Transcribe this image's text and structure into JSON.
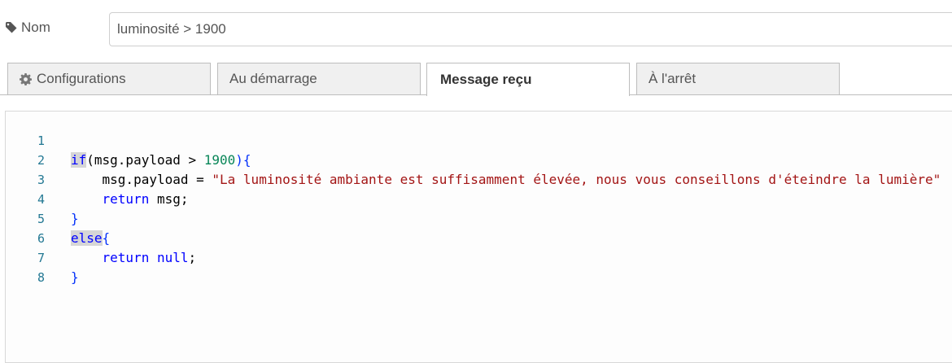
{
  "name_field": {
    "label": "Nom",
    "value": "luminosité > 1900"
  },
  "tabs": [
    {
      "label": "Configurations",
      "icon": "gear-icon",
      "active": false
    },
    {
      "label": "Au démarrage",
      "active": false
    },
    {
      "label": "Message reçu",
      "active": true
    },
    {
      "label": "À l'arrêt",
      "active": false
    }
  ],
  "editor": {
    "line_numbers": [
      "1",
      "2",
      "3",
      "4",
      "5",
      "6",
      "7",
      "8"
    ],
    "lines": {
      "l1": {
        "kw": "if",
        "a": "(msg.payload > ",
        "num": "1900",
        "b": "){"
      },
      "l2": {
        "indent": "    ",
        "a": "msg.payload = ",
        "str": "\"La luminosité ambiante est suffisamment élevée, nous vous conseillons d'éteindre la lumière\""
      },
      "l3": {
        "indent": "    ",
        "kw": "return",
        "a": " msg;"
      },
      "l4": {
        "a": "}"
      },
      "l5": {
        "kw": "else",
        "a": "{"
      },
      "l6": {
        "indent": "    ",
        "kw": "return",
        "a": " ",
        "kw2": "null",
        "b": ";"
      },
      "l7": {
        "a": "}"
      },
      "l8": {
        "a": ""
      }
    }
  },
  "colors": {
    "keyword": "#0000ff",
    "number": "#098658",
    "string": "#a31515",
    "line_number": "#237893"
  }
}
